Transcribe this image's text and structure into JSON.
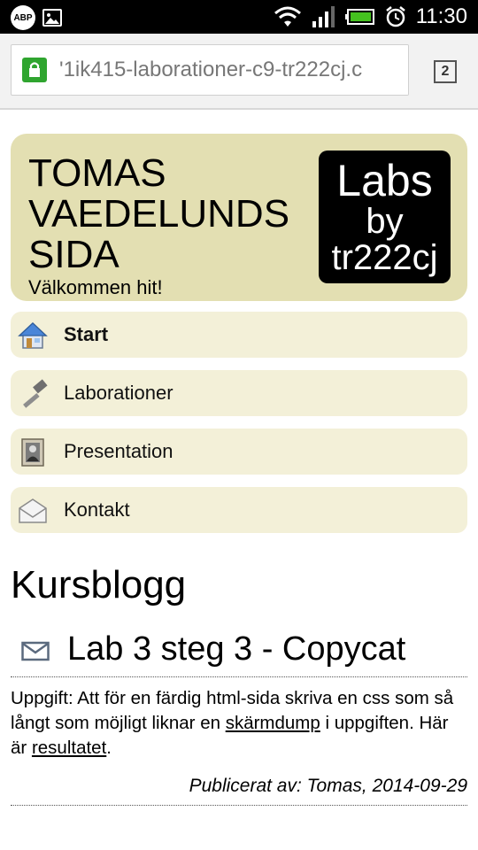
{
  "status_bar": {
    "time": "11:30",
    "abp_label": "ABP"
  },
  "browser": {
    "url_text": "'1ik415-laborationer-c9-tr222cj.c",
    "tab_count": "2"
  },
  "header": {
    "title": "TOMAS VAEDELUNDS SIDA",
    "subtitle": "Välkommen hit!",
    "logo_lines": [
      "Labs",
      "by",
      "tr222cj"
    ]
  },
  "nav": {
    "items": [
      {
        "label": "Start",
        "icon": "home-icon"
      },
      {
        "label": "Laborationer",
        "icon": "hammer-icon"
      },
      {
        "label": "Presentation",
        "icon": "portrait-icon"
      },
      {
        "label": "Kontakt",
        "icon": "envelope-icon"
      }
    ]
  },
  "main": {
    "heading": "Kursblogg",
    "post": {
      "title": "Lab 3 steg 3 - Copycat",
      "body_before_link1": "Uppgift: Att för en färdig html-sida skriva en css som så långt som möjligt liknar en ",
      "link1": "skärmdump",
      "body_between": " i uppgiften. Här är ",
      "link2": "resultatet",
      "body_after": ".",
      "byline": "Publicerat av: Tomas, 2014-09-29"
    }
  },
  "colors": {
    "header_bg": "#e3dfb2",
    "nav_bg": "#f3f0d8",
    "lock_green": "#2fa52f"
  }
}
